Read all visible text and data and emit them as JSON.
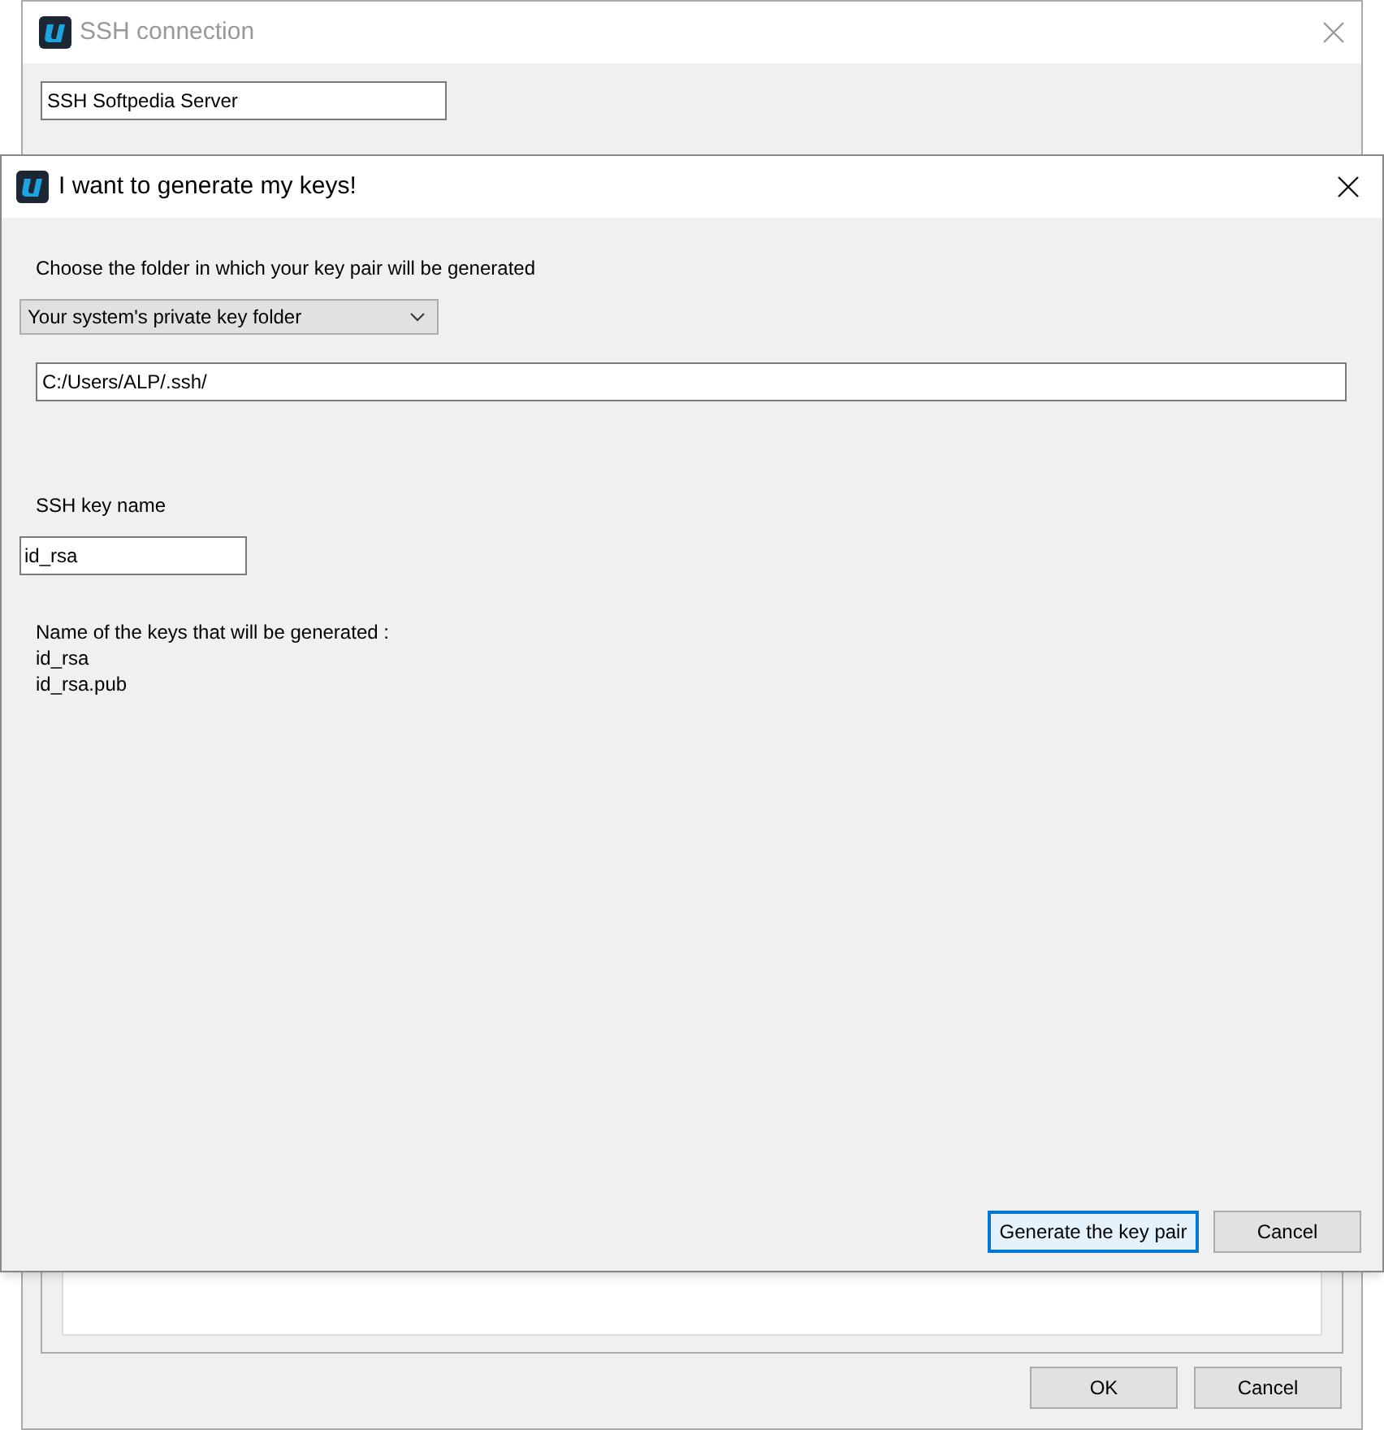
{
  "background_window": {
    "title": "SSH connection",
    "active": false,
    "name_field": {
      "value": "SSH Softpedia Server"
    },
    "buttons": [
      {
        "label": "OK",
        "focused": false
      },
      {
        "label": "Cancel",
        "focused": false
      }
    ]
  },
  "dialog": {
    "title": "I want to generate my keys!",
    "active": true,
    "folder_label": "Choose the folder in which your key pair will be generated",
    "folder_select": {
      "value": "Your system's private key folder"
    },
    "path_field": {
      "value": "C:/Users/ALP/.ssh/"
    },
    "key_name_label": "SSH key name",
    "key_name_field": {
      "value": "id_rsa"
    },
    "keys_heading": "Name of the keys that will be generated :",
    "key_files": [
      "id_rsa",
      "id_rsa.pub"
    ],
    "buttons": [
      {
        "label": "Generate the key pair",
        "focused": true
      },
      {
        "label": "Cancel",
        "focused": false
      }
    ]
  }
}
